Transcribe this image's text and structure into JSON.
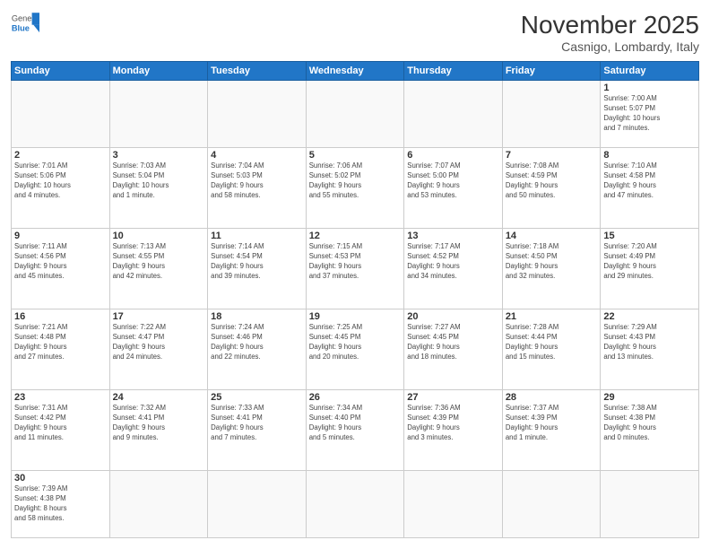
{
  "header": {
    "logo_general": "General",
    "logo_blue": "Blue",
    "month": "November 2025",
    "location": "Casnigo, Lombardy, Italy"
  },
  "weekdays": [
    "Sunday",
    "Monday",
    "Tuesday",
    "Wednesday",
    "Thursday",
    "Friday",
    "Saturday"
  ],
  "weeks": [
    [
      {
        "day": "",
        "info": ""
      },
      {
        "day": "",
        "info": ""
      },
      {
        "day": "",
        "info": ""
      },
      {
        "day": "",
        "info": ""
      },
      {
        "day": "",
        "info": ""
      },
      {
        "day": "",
        "info": ""
      },
      {
        "day": "1",
        "info": "Sunrise: 7:00 AM\nSunset: 5:07 PM\nDaylight: 10 hours\nand 7 minutes."
      }
    ],
    [
      {
        "day": "2",
        "info": "Sunrise: 7:01 AM\nSunset: 5:06 PM\nDaylight: 10 hours\nand 4 minutes."
      },
      {
        "day": "3",
        "info": "Sunrise: 7:03 AM\nSunset: 5:04 PM\nDaylight: 10 hours\nand 1 minute."
      },
      {
        "day": "4",
        "info": "Sunrise: 7:04 AM\nSunset: 5:03 PM\nDaylight: 9 hours\nand 58 minutes."
      },
      {
        "day": "5",
        "info": "Sunrise: 7:06 AM\nSunset: 5:02 PM\nDaylight: 9 hours\nand 55 minutes."
      },
      {
        "day": "6",
        "info": "Sunrise: 7:07 AM\nSunset: 5:00 PM\nDaylight: 9 hours\nand 53 minutes."
      },
      {
        "day": "7",
        "info": "Sunrise: 7:08 AM\nSunset: 4:59 PM\nDaylight: 9 hours\nand 50 minutes."
      },
      {
        "day": "8",
        "info": "Sunrise: 7:10 AM\nSunset: 4:58 PM\nDaylight: 9 hours\nand 47 minutes."
      }
    ],
    [
      {
        "day": "9",
        "info": "Sunrise: 7:11 AM\nSunset: 4:56 PM\nDaylight: 9 hours\nand 45 minutes."
      },
      {
        "day": "10",
        "info": "Sunrise: 7:13 AM\nSunset: 4:55 PM\nDaylight: 9 hours\nand 42 minutes."
      },
      {
        "day": "11",
        "info": "Sunrise: 7:14 AM\nSunset: 4:54 PM\nDaylight: 9 hours\nand 39 minutes."
      },
      {
        "day": "12",
        "info": "Sunrise: 7:15 AM\nSunset: 4:53 PM\nDaylight: 9 hours\nand 37 minutes."
      },
      {
        "day": "13",
        "info": "Sunrise: 7:17 AM\nSunset: 4:52 PM\nDaylight: 9 hours\nand 34 minutes."
      },
      {
        "day": "14",
        "info": "Sunrise: 7:18 AM\nSunset: 4:50 PM\nDaylight: 9 hours\nand 32 minutes."
      },
      {
        "day": "15",
        "info": "Sunrise: 7:20 AM\nSunset: 4:49 PM\nDaylight: 9 hours\nand 29 minutes."
      }
    ],
    [
      {
        "day": "16",
        "info": "Sunrise: 7:21 AM\nSunset: 4:48 PM\nDaylight: 9 hours\nand 27 minutes."
      },
      {
        "day": "17",
        "info": "Sunrise: 7:22 AM\nSunset: 4:47 PM\nDaylight: 9 hours\nand 24 minutes."
      },
      {
        "day": "18",
        "info": "Sunrise: 7:24 AM\nSunset: 4:46 PM\nDaylight: 9 hours\nand 22 minutes."
      },
      {
        "day": "19",
        "info": "Sunrise: 7:25 AM\nSunset: 4:45 PM\nDaylight: 9 hours\nand 20 minutes."
      },
      {
        "day": "20",
        "info": "Sunrise: 7:27 AM\nSunset: 4:45 PM\nDaylight: 9 hours\nand 18 minutes."
      },
      {
        "day": "21",
        "info": "Sunrise: 7:28 AM\nSunset: 4:44 PM\nDaylight: 9 hours\nand 15 minutes."
      },
      {
        "day": "22",
        "info": "Sunrise: 7:29 AM\nSunset: 4:43 PM\nDaylight: 9 hours\nand 13 minutes."
      }
    ],
    [
      {
        "day": "23",
        "info": "Sunrise: 7:31 AM\nSunset: 4:42 PM\nDaylight: 9 hours\nand 11 minutes."
      },
      {
        "day": "24",
        "info": "Sunrise: 7:32 AM\nSunset: 4:41 PM\nDaylight: 9 hours\nand 9 minutes."
      },
      {
        "day": "25",
        "info": "Sunrise: 7:33 AM\nSunset: 4:41 PM\nDaylight: 9 hours\nand 7 minutes."
      },
      {
        "day": "26",
        "info": "Sunrise: 7:34 AM\nSunset: 4:40 PM\nDaylight: 9 hours\nand 5 minutes."
      },
      {
        "day": "27",
        "info": "Sunrise: 7:36 AM\nSunset: 4:39 PM\nDaylight: 9 hours\nand 3 minutes."
      },
      {
        "day": "28",
        "info": "Sunrise: 7:37 AM\nSunset: 4:39 PM\nDaylight: 9 hours\nand 1 minute."
      },
      {
        "day": "29",
        "info": "Sunrise: 7:38 AM\nSunset: 4:38 PM\nDaylight: 9 hours\nand 0 minutes."
      }
    ],
    [
      {
        "day": "30",
        "info": "Sunrise: 7:39 AM\nSunset: 4:38 PM\nDaylight: 8 hours\nand 58 minutes."
      },
      {
        "day": "",
        "info": ""
      },
      {
        "day": "",
        "info": ""
      },
      {
        "day": "",
        "info": ""
      },
      {
        "day": "",
        "info": ""
      },
      {
        "day": "",
        "info": ""
      },
      {
        "day": "",
        "info": ""
      }
    ]
  ]
}
